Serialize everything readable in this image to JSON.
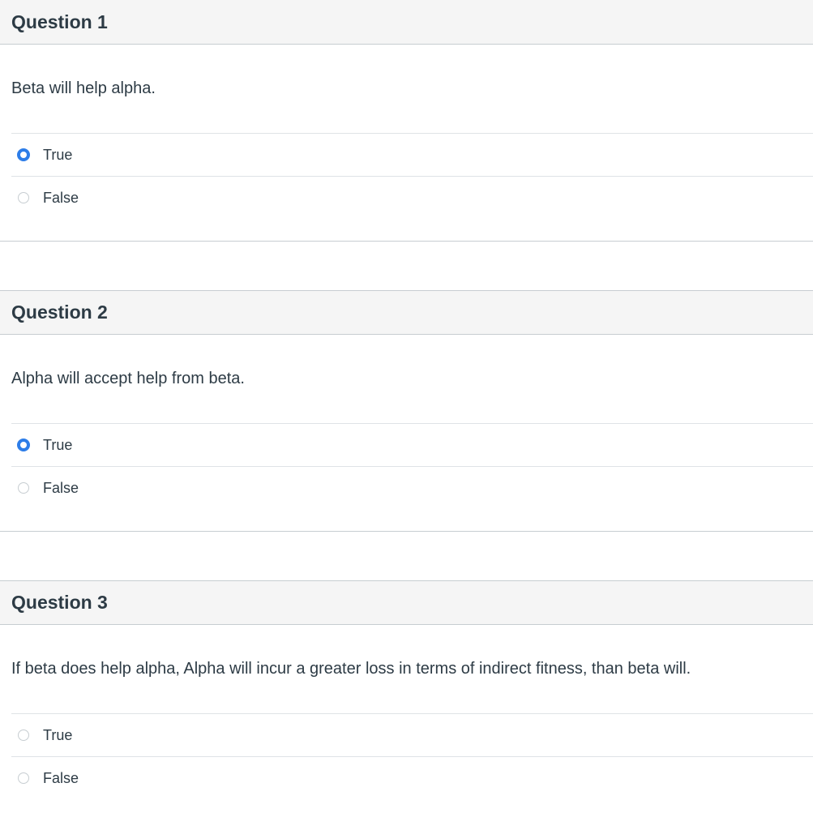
{
  "questions": [
    {
      "title": "Question 1",
      "text": "Beta will help alpha.",
      "answers": [
        {
          "label": "True",
          "selected": true
        },
        {
          "label": "False",
          "selected": false
        }
      ]
    },
    {
      "title": "Question 2",
      "text": "Alpha will accept help from beta.",
      "answers": [
        {
          "label": "True",
          "selected": true
        },
        {
          "label": "False",
          "selected": false
        }
      ]
    },
    {
      "title": "Question 3",
      "text": "If beta does help alpha, Alpha will incur a greater loss in terms of indirect fitness, than beta will.",
      "answers": [
        {
          "label": "True",
          "selected": false
        },
        {
          "label": "False",
          "selected": false
        }
      ]
    }
  ],
  "colors": {
    "accent": "#2d7de8",
    "header_bg": "#f5f5f5",
    "text": "#2d3b45",
    "border": "#c7cdd1"
  }
}
